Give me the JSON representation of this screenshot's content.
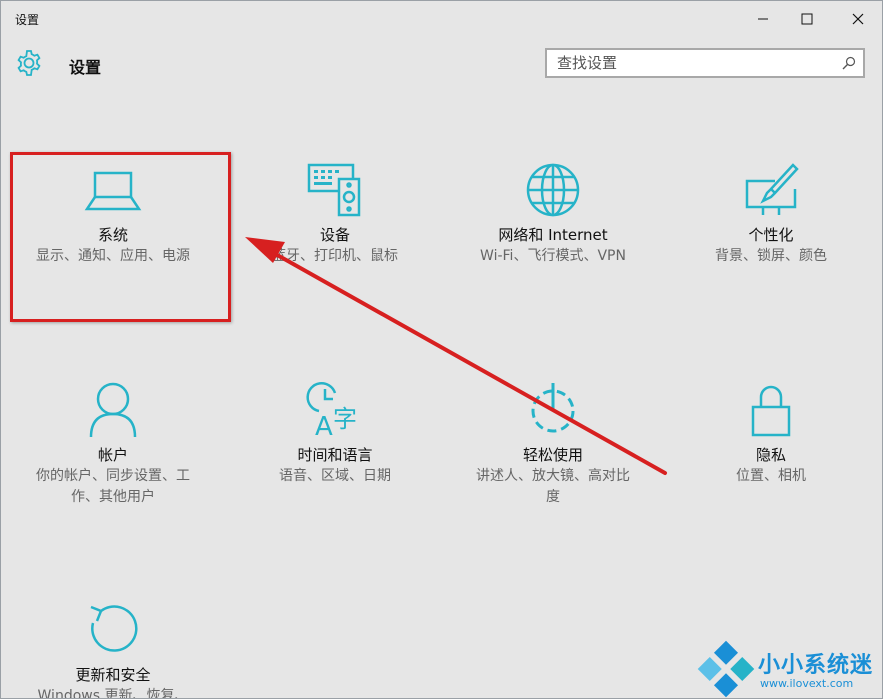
{
  "window": {
    "title": "设置",
    "controls": {
      "minimize": "minimize",
      "maximize": "maximize",
      "close": "close"
    }
  },
  "header": {
    "title": "设置",
    "search_placeholder": "查找设置"
  },
  "tiles": [
    {
      "title": "系统",
      "desc": "显示、通知、应用、电源",
      "icon": "laptop-icon"
    },
    {
      "title": "设备",
      "desc": "蓝牙、打印机、鼠标",
      "icon": "devices-icon"
    },
    {
      "title": "网络和 Internet",
      "desc": "Wi-Fi、飞行模式、VPN",
      "icon": "globe-icon"
    },
    {
      "title": "个性化",
      "desc": "背景、锁屏、颜色",
      "icon": "paint-icon"
    },
    {
      "title": "帐户",
      "desc": "你的帐户、同步设置、工作、其他用户",
      "icon": "person-icon"
    },
    {
      "title": "时间和语言",
      "desc": "语音、区域、日期",
      "icon": "time-language-icon"
    },
    {
      "title": "轻松使用",
      "desc": "讲述人、放大镜、高对比度",
      "icon": "ease-of-access-icon"
    },
    {
      "title": "隐私",
      "desc": "位置、相机",
      "icon": "lock-icon"
    },
    {
      "title": "更新和安全",
      "desc": "Windows 更新、恢复、备份",
      "icon": "update-icon"
    }
  ],
  "colors": {
    "accent": "#26b3c8",
    "annotation": "#d72020",
    "watermark": "#1a8fd6"
  },
  "watermark": {
    "title": "小小系统迷",
    "url": "www.ilovext.com"
  }
}
